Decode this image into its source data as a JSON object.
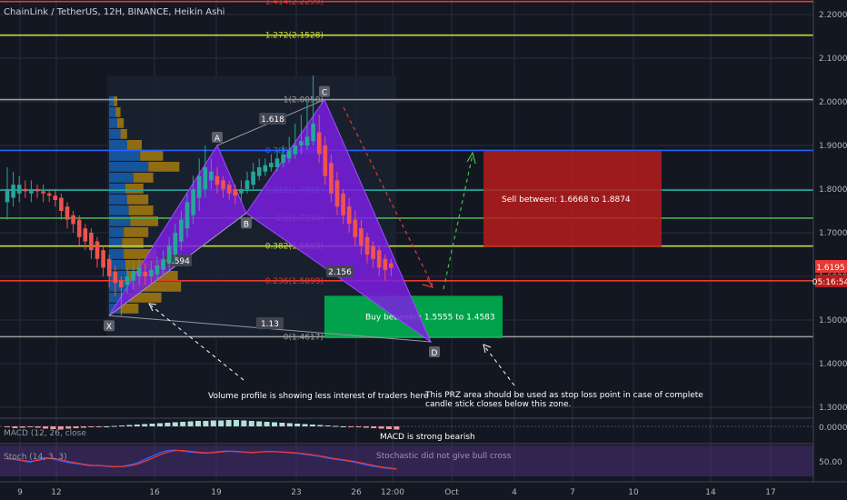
{
  "header": {
    "symbol_title": "ChainLink / TetherUS, 12H, BINANCE, Heikin Ashi"
  },
  "indicators": {
    "macd_label": "MACD (12, 26, close",
    "stoch_label": "Stoch (14, 3, 3)"
  },
  "price_scale": {
    "current_price": "1.6195",
    "countdown": "05:16:54",
    "macd_zero": "0.0000",
    "stoch_mid": "50.00"
  },
  "chart_data": {
    "type": "candlestick",
    "style": "Heikin Ashi",
    "ylim": [
      1.2,
      2.2
    ],
    "price_ticks": [
      "2.2000",
      "2.1000",
      "2.0000",
      "1.9000",
      "1.8000",
      "1.7000",
      "1.6000",
      "1.5000",
      "1.4000",
      "1.3000"
    ],
    "time_ticks": [
      "9",
      "12",
      "16",
      "19",
      "23",
      "26",
      "12:00",
      "Oct",
      "4",
      "7",
      "10",
      "14",
      "17"
    ],
    "fib_levels": [
      {
        "label": "1.414(2.2299)",
        "price": 2.2299,
        "color": "#e53935"
      },
      {
        "label": "1.272(2.1528)",
        "price": 2.1528,
        "color": "#c6d93a"
      },
      {
        "label": "1(2.0050)",
        "price": 2.005,
        "color": "#9e9e9e"
      },
      {
        "label": "0.786(1.8887)",
        "price": 1.8887,
        "color": "#2962ff"
      },
      {
        "label": "0.618(1.7975)",
        "price": 1.7975,
        "color": "#26a69a"
      },
      {
        "label": "0.5(1.7334)",
        "price": 1.7334,
        "color": "#4caf50"
      },
      {
        "label": "0.382(1.6693)",
        "price": 1.6693,
        "color": "#c6d93a"
      },
      {
        "label": "0.236(1.5899)",
        "price": 1.5899,
        "color": "#e53935"
      },
      {
        "label": "0(1.4617)",
        "price": 1.4617,
        "color": "#9e9e9e"
      }
    ],
    "pattern_points": [
      {
        "label": "X",
        "price": 1.51
      },
      {
        "label": "A",
        "price": 1.9
      },
      {
        "label": "B",
        "price": 1.745
      },
      {
        "label": "C",
        "price": 2.005
      },
      {
        "label": "D",
        "price": 1.45
      }
    ],
    "pattern_ratios": [
      "1.618",
      "0.594",
      "1.13",
      "2.156"
    ],
    "zones": {
      "sell": {
        "text": "Sell between: 1.6668 to 1.8874",
        "from": 1.6668,
        "to": 1.8874
      },
      "buy": {
        "text": "Buy between: 1.5555 to 1.4583",
        "from": 1.4583,
        "to": 1.5555
      }
    },
    "annotations": [
      "Volume profile is showing less interest of traders here",
      "This PRZ area should be used as stop loss point in case of complete",
      "candle stick closes below this zone.",
      "MACD is strong bearish",
      "Stochastic did not give bull cross"
    ],
    "candles": [
      {
        "o": 1.77,
        "c": 1.8,
        "h": 1.85,
        "l": 1.73
      },
      {
        "o": 1.78,
        "c": 1.81,
        "h": 1.84,
        "l": 1.76
      },
      {
        "o": 1.79,
        "c": 1.81,
        "h": 1.83,
        "l": 1.77
      },
      {
        "o": 1.8,
        "c": 1.795,
        "h": 1.82,
        "l": 1.78
      },
      {
        "o": 1.79,
        "c": 1.8,
        "h": 1.82,
        "l": 1.77
      },
      {
        "o": 1.8,
        "c": 1.795,
        "h": 1.81,
        "l": 1.78
      },
      {
        "o": 1.795,
        "c": 1.79,
        "h": 1.81,
        "l": 1.77
      },
      {
        "o": 1.79,
        "c": 1.785,
        "h": 1.8,
        "l": 1.77
      },
      {
        "o": 1.785,
        "c": 1.775,
        "h": 1.8,
        "l": 1.76
      },
      {
        "o": 1.78,
        "c": 1.75,
        "h": 1.79,
        "l": 1.73
      },
      {
        "o": 1.76,
        "c": 1.73,
        "h": 1.77,
        "l": 1.71
      },
      {
        "o": 1.74,
        "c": 1.72,
        "h": 1.75,
        "l": 1.7
      },
      {
        "o": 1.73,
        "c": 1.69,
        "h": 1.74,
        "l": 1.67
      },
      {
        "o": 1.71,
        "c": 1.68,
        "h": 1.72,
        "l": 1.66
      },
      {
        "o": 1.7,
        "c": 1.66,
        "h": 1.71,
        "l": 1.64
      },
      {
        "o": 1.68,
        "c": 1.64,
        "h": 1.69,
        "l": 1.62
      },
      {
        "o": 1.66,
        "c": 1.62,
        "h": 1.67,
        "l": 1.6
      },
      {
        "o": 1.64,
        "c": 1.6,
        "h": 1.65,
        "l": 1.575
      },
      {
        "o": 1.61,
        "c": 1.585,
        "h": 1.625,
        "l": 1.555
      },
      {
        "o": 1.59,
        "c": 1.575,
        "h": 1.6,
        "l": 1.51
      },
      {
        "o": 1.58,
        "c": 1.6,
        "h": 1.62,
        "l": 1.56
      },
      {
        "o": 1.59,
        "c": 1.61,
        "h": 1.635,
        "l": 1.57
      },
      {
        "o": 1.6,
        "c": 1.62,
        "h": 1.64,
        "l": 1.58
      },
      {
        "o": 1.61,
        "c": 1.6,
        "h": 1.63,
        "l": 1.58
      },
      {
        "o": 1.6,
        "c": 1.615,
        "h": 1.635,
        "l": 1.585
      },
      {
        "o": 1.605,
        "c": 1.625,
        "h": 1.645,
        "l": 1.59
      },
      {
        "o": 1.615,
        "c": 1.64,
        "h": 1.66,
        "l": 1.6
      },
      {
        "o": 1.63,
        "c": 1.67,
        "h": 1.69,
        "l": 1.61
      },
      {
        "o": 1.65,
        "c": 1.7,
        "h": 1.72,
        "l": 1.63
      },
      {
        "o": 1.68,
        "c": 1.73,
        "h": 1.75,
        "l": 1.66
      },
      {
        "o": 1.71,
        "c": 1.77,
        "h": 1.79,
        "l": 1.69
      },
      {
        "o": 1.74,
        "c": 1.8,
        "h": 1.83,
        "l": 1.72
      },
      {
        "o": 1.78,
        "c": 1.83,
        "h": 1.87,
        "l": 1.75
      },
      {
        "o": 1.8,
        "c": 1.85,
        "h": 1.9,
        "l": 1.78
      },
      {
        "o": 1.82,
        "c": 1.84,
        "h": 1.87,
        "l": 1.8
      },
      {
        "o": 1.83,
        "c": 1.81,
        "h": 1.85,
        "l": 1.79
      },
      {
        "o": 1.82,
        "c": 1.8,
        "h": 1.83,
        "l": 1.78
      },
      {
        "o": 1.81,
        "c": 1.79,
        "h": 1.82,
        "l": 1.775
      },
      {
        "o": 1.8,
        "c": 1.785,
        "h": 1.81,
        "l": 1.765
      },
      {
        "o": 1.79,
        "c": 1.8,
        "h": 1.82,
        "l": 1.77
      },
      {
        "o": 1.8,
        "c": 1.82,
        "h": 1.84,
        "l": 1.79
      },
      {
        "o": 1.81,
        "c": 1.84,
        "h": 1.86,
        "l": 1.8
      },
      {
        "o": 1.83,
        "c": 1.85,
        "h": 1.87,
        "l": 1.82
      },
      {
        "o": 1.84,
        "c": 1.855,
        "h": 1.87,
        "l": 1.83
      },
      {
        "o": 1.85,
        "c": 1.86,
        "h": 1.88,
        "l": 1.84
      },
      {
        "o": 1.85,
        "c": 1.87,
        "h": 1.89,
        "l": 1.84
      },
      {
        "o": 1.86,
        "c": 1.88,
        "h": 1.9,
        "l": 1.85
      },
      {
        "o": 1.87,
        "c": 1.89,
        "h": 1.92,
        "l": 1.86
      },
      {
        "o": 1.88,
        "c": 1.9,
        "h": 1.95,
        "l": 1.87
      },
      {
        "o": 1.9,
        "c": 1.91,
        "h": 1.97,
        "l": 1.88
      },
      {
        "o": 1.9,
        "c": 1.92,
        "h": 2.0,
        "l": 1.89
      },
      {
        "o": 1.91,
        "c": 1.95,
        "h": 2.06,
        "l": 1.9
      },
      {
        "o": 1.93,
        "c": 1.88,
        "h": 1.97,
        "l": 1.86
      },
      {
        "o": 1.9,
        "c": 1.83,
        "h": 1.92,
        "l": 1.81
      },
      {
        "o": 1.86,
        "c": 1.79,
        "h": 1.88,
        "l": 1.77
      },
      {
        "o": 1.82,
        "c": 1.76,
        "h": 1.84,
        "l": 1.74
      },
      {
        "o": 1.79,
        "c": 1.74,
        "h": 1.8,
        "l": 1.72
      },
      {
        "o": 1.76,
        "c": 1.72,
        "h": 1.78,
        "l": 1.7
      },
      {
        "o": 1.73,
        "c": 1.69,
        "h": 1.75,
        "l": 1.67
      },
      {
        "o": 1.71,
        "c": 1.67,
        "h": 1.73,
        "l": 1.65
      },
      {
        "o": 1.69,
        "c": 1.65,
        "h": 1.7,
        "l": 1.63
      },
      {
        "o": 1.67,
        "c": 1.64,
        "h": 1.68,
        "l": 1.62
      },
      {
        "o": 1.66,
        "c": 1.62,
        "h": 1.67,
        "l": 1.6
      },
      {
        "o": 1.64,
        "c": 1.615,
        "h": 1.65,
        "l": 1.59
      },
      {
        "o": 1.63,
        "c": 1.6195,
        "h": 1.64,
        "l": 1.6
      }
    ],
    "volume_profile": [
      {
        "price": 2.0,
        "up": 6,
        "down": 4
      },
      {
        "price": 1.975,
        "up": 8,
        "down": 6
      },
      {
        "price": 1.95,
        "up": 10,
        "down": 8
      },
      {
        "price": 1.925,
        "up": 14,
        "down": 8
      },
      {
        "price": 1.9,
        "up": 22,
        "down": 18
      },
      {
        "price": 1.875,
        "up": 38,
        "down": 28
      },
      {
        "price": 1.85,
        "up": 48,
        "down": 38
      },
      {
        "price": 1.825,
        "up": 30,
        "down": 24
      },
      {
        "price": 1.8,
        "up": 20,
        "down": 22
      },
      {
        "price": 1.775,
        "up": 22,
        "down": 26
      },
      {
        "price": 1.75,
        "up": 24,
        "down": 30
      },
      {
        "price": 1.725,
        "up": 26,
        "down": 34
      },
      {
        "price": 1.7,
        "up": 18,
        "down": 30
      },
      {
        "price": 1.675,
        "up": 16,
        "down": 26
      },
      {
        "price": 1.65,
        "up": 18,
        "down": 40
      },
      {
        "price": 1.625,
        "up": 20,
        "down": 50
      },
      {
        "price": 1.6,
        "up": 22,
        "down": 62
      },
      {
        "price": 1.575,
        "up": 28,
        "down": 60
      },
      {
        "price": 1.55,
        "up": 24,
        "down": 40
      },
      {
        "price": 1.525,
        "up": 14,
        "down": 22
      }
    ],
    "macd": [
      -0.002,
      -0.004,
      -0.003,
      -0.002,
      -0.003,
      -0.005,
      -0.006,
      -0.007,
      -0.005,
      -0.004,
      -0.003,
      -0.002,
      -0.001,
      0.0,
      0.001,
      0.002,
      0.003,
      0.004,
      0.005,
      0.006,
      0.007,
      0.008,
      0.009,
      0.01,
      0.011,
      0.012,
      0.012,
      0.013,
      0.013,
      0.014,
      0.014,
      0.013,
      0.012,
      0.011,
      0.01,
      0.009,
      0.008,
      0.007,
      0.006,
      0.005,
      0.004,
      0.003,
      0.002,
      0.001,
      0.0,
      -0.001,
      -0.002,
      -0.003,
      -0.004,
      -0.005,
      -0.006,
      -0.007
    ],
    "stoch": {
      "k": [
        60,
        55,
        50,
        45,
        55,
        62,
        58,
        50,
        44,
        40,
        36,
        32,
        34,
        30,
        28,
        30,
        35,
        42,
        55,
        68,
        80,
        88,
        90,
        86,
        82,
        80,
        78,
        82,
        85,
        86,
        84,
        82,
        80,
        83,
        85,
        84,
        82,
        80,
        78,
        74,
        70,
        66,
        60,
        56,
        52,
        48,
        42,
        36,
        30,
        26,
        22,
        20
      ],
      "d": [
        58,
        56,
        52,
        48,
        52,
        58,
        60,
        54,
        48,
        43,
        38,
        34,
        33,
        31,
        29,
        29,
        32,
        38,
        48,
        60,
        72,
        82,
        88,
        88,
        85,
        82,
        80,
        80,
        83,
        85,
        85,
        83,
        81,
        82,
        84,
        84,
        83,
        81,
        79,
        76,
        72,
        68,
        63,
        58,
        54,
        50,
        45,
        39,
        33,
        28,
        24,
        21
      ]
    }
  }
}
